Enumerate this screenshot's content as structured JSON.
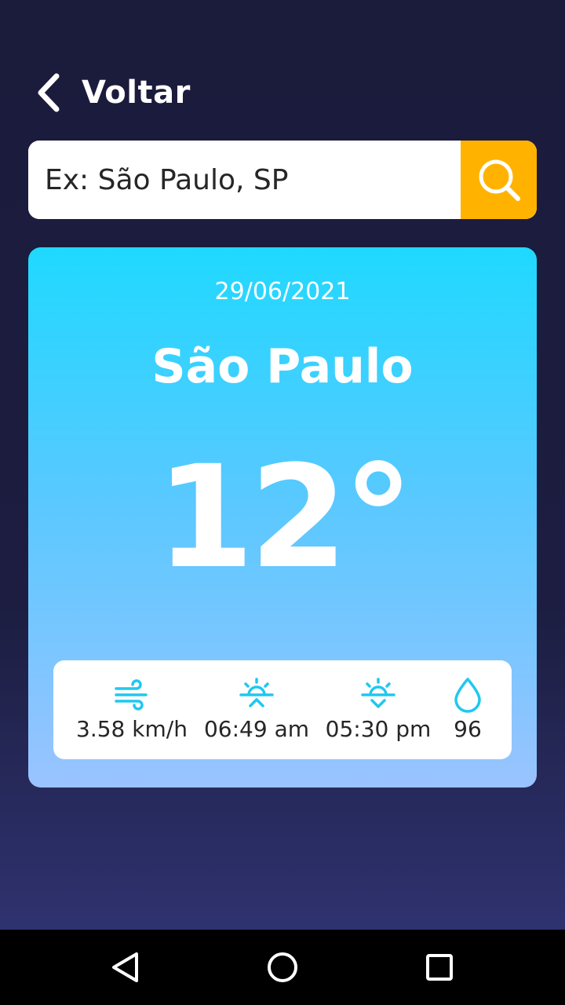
{
  "header": {
    "back_label": "Voltar"
  },
  "search": {
    "placeholder": "Ex: São Paulo, SP"
  },
  "weather": {
    "date": "29/06/2021",
    "city": "São Paulo",
    "temperature": "12°"
  },
  "stats": {
    "wind": "3.58 km/h",
    "sunrise": "06:49 am",
    "sunset": "05:30 pm",
    "humidity": "96"
  },
  "colors": {
    "background": "#1b1b3c",
    "accent": "#ffb300",
    "icon": "#1fc8ef",
    "card_top": "#1fd9ff",
    "card_bottom": "#9ac3ff"
  },
  "icons": {
    "back": "chevron-left-icon",
    "search": "search-icon",
    "wind": "wind-icon",
    "sunrise": "sunrise-icon",
    "sunset": "sunset-icon",
    "humidity": "drop-icon"
  }
}
